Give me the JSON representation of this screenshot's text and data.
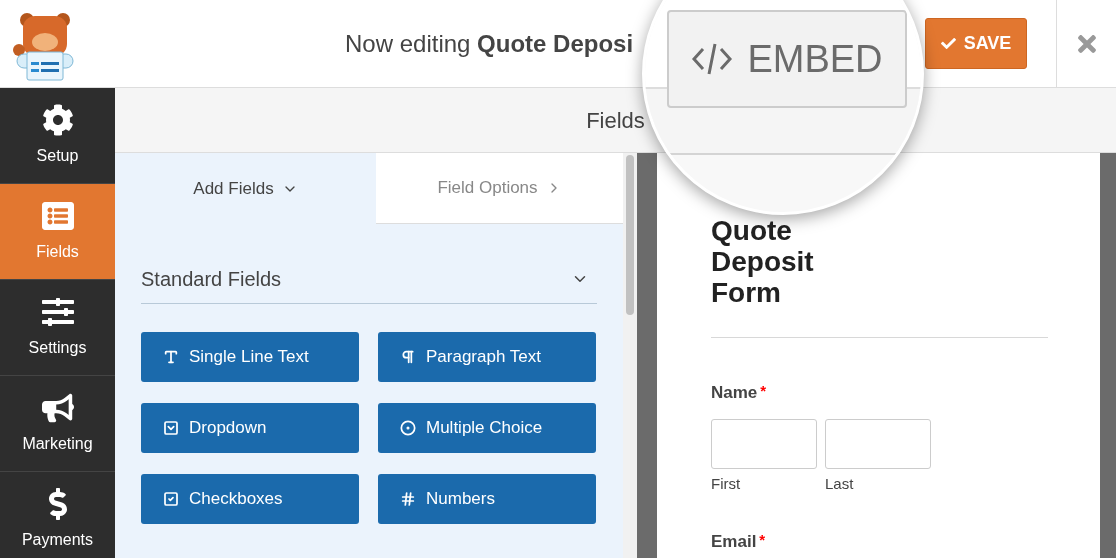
{
  "header": {
    "title": "Now editing **Quote Deposi**",
    "embed_button": "EMBED",
    "save_button": "SAVE"
  },
  "sidebar": {
    "items": [
      {
        "label": "Setup",
        "kind": "setup",
        "selected": false
      },
      {
        "label": "Fields",
        "kind": "fields",
        "selected": true
      },
      {
        "label": "Settings",
        "kind": "settings",
        "selected": false
      },
      {
        "label": "Marketing",
        "kind": "marketing",
        "selected": false
      },
      {
        "label": "Payments",
        "kind": "payments",
        "selected": false
      }
    ]
  },
  "panel_title": "Fields",
  "tabs": [
    {
      "label": "Add Fields",
      "selected": true
    },
    {
      "label": "Field Options",
      "selected": false
    }
  ],
  "section": {
    "title": "Standard Fields",
    "expanded": true
  },
  "field_buttons": [
    {
      "label": "Single Line Text",
      "kind": "text"
    },
    {
      "label": "Paragraph Text",
      "kind": "paragraph"
    },
    {
      "label": "Dropdown",
      "kind": "dropdown"
    },
    {
      "label": "Multiple Choice",
      "kind": "radio"
    },
    {
      "label": "Checkboxes",
      "kind": "checkbox"
    },
    {
      "label": "Numbers",
      "kind": "number"
    }
  ],
  "form": {
    "title": "Quote Deposit Form",
    "fields": [
      {
        "label": "Name",
        "required_mark": "*",
        "sub_fields": [
          "First",
          "Last"
        ]
      },
      {
        "label": "Email",
        "required_mark": "*"
      }
    ]
  }
}
